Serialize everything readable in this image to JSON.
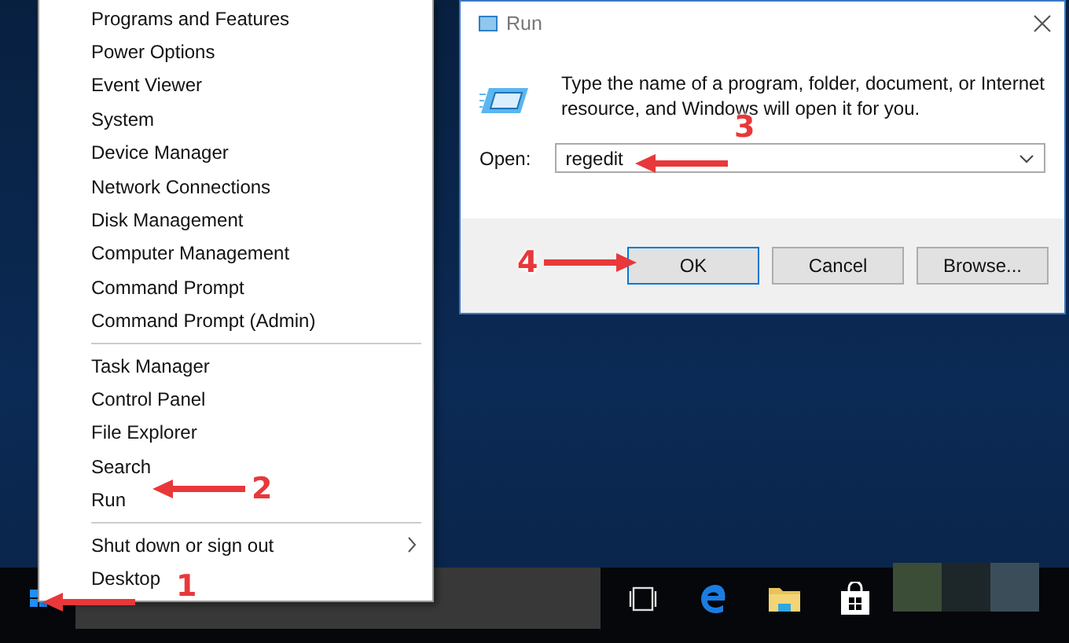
{
  "context_menu": {
    "sections": [
      [
        {
          "label": "Programs and Features",
          "has_submenu": false
        },
        {
          "label": "Power Options",
          "has_submenu": false
        },
        {
          "label": "Event Viewer",
          "has_submenu": false
        },
        {
          "label": "System",
          "has_submenu": false
        },
        {
          "label": "Device Manager",
          "has_submenu": false
        },
        {
          "label": "Network Connections",
          "has_submenu": false
        },
        {
          "label": "Disk Management",
          "has_submenu": false
        },
        {
          "label": "Computer Management",
          "has_submenu": false
        },
        {
          "label": "Command Prompt",
          "has_submenu": false
        },
        {
          "label": "Command Prompt (Admin)",
          "has_submenu": false
        }
      ],
      [
        {
          "label": "Task Manager",
          "has_submenu": false
        },
        {
          "label": "Control Panel",
          "has_submenu": false
        },
        {
          "label": "File Explorer",
          "has_submenu": false
        },
        {
          "label": "Search",
          "has_submenu": false
        },
        {
          "label": "Run",
          "has_submenu": false
        }
      ],
      [
        {
          "label": "Shut down or sign out",
          "has_submenu": true
        },
        {
          "label": "Desktop",
          "has_submenu": false
        }
      ]
    ]
  },
  "run_dialog": {
    "title": "Run",
    "description": "Type the name of a program, folder, document, or Internet resource, and Windows will open it for you.",
    "open_label": "Open:",
    "open_value": "regedit",
    "buttons": [
      {
        "label": "OK",
        "default": true
      },
      {
        "label": "Cancel",
        "default": false
      },
      {
        "label": "Browse...",
        "default": false
      }
    ]
  },
  "annotations": [
    {
      "number": "1",
      "kind": "arrow-left"
    },
    {
      "number": "2",
      "kind": "arrow-left"
    },
    {
      "number": "3",
      "kind": "arrow-left"
    },
    {
      "number": "4",
      "kind": "arrow-right"
    }
  ]
}
